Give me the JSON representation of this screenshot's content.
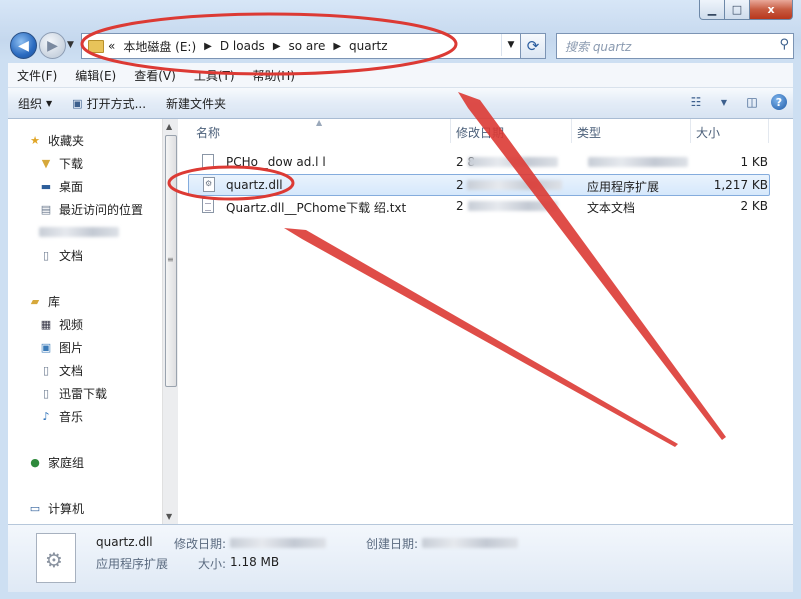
{
  "window": {
    "minimize_icon": "minimize-icon",
    "maximize_icon": "maximize-icon",
    "close_icon": "close-icon",
    "close_glyph": "x"
  },
  "address": {
    "overflow": "«",
    "crumbs": [
      "本地磁盘 (E:)",
      "D      loads",
      "so      are",
      "quartz"
    ]
  },
  "search": {
    "placeholder": "搜索 quartz"
  },
  "menu": [
    "文件(F)",
    "编辑(E)",
    "查看(V)",
    "工具(T)",
    "帮助(H)"
  ],
  "toolbar": {
    "organize": "组织",
    "open_with": "打开方式...",
    "new_folder": "新建文件夹"
  },
  "nav": {
    "favorites": "收藏夹",
    "downloads": "下载",
    "desktop": "桌面",
    "recent": "最近访问的位置",
    "documents_fav": "文档",
    "library": "库",
    "videos": "视频",
    "pictures": "图片",
    "documents": "文档",
    "xunlei": "迅雷下载",
    "music": "音乐",
    "homegroup": "家庭组",
    "computer": "计算机"
  },
  "columns": {
    "name": "名称",
    "modified": "修改日期",
    "type": "类型",
    "size": "大小"
  },
  "files": [
    {
      "name": "PCHo    _dow    ad.l    l",
      "modified": "2            8",
      "type": "",
      "size": "1 KB"
    },
    {
      "name": "quartz.dll",
      "modified": "2",
      "type": "应用程序扩展",
      "size": "1,217 KB"
    },
    {
      "name": "Quartz.dll__PChome下载     绍.txt",
      "modified": "2",
      "type": "文本文档",
      "size": "2 KB"
    }
  ],
  "details": {
    "filename": "quartz.dll",
    "filetype": "应用程序扩展",
    "modified_label": "修改日期:",
    "created_label": "创建日期:",
    "size_label": "大小:",
    "size_value": "1.18 MB"
  }
}
